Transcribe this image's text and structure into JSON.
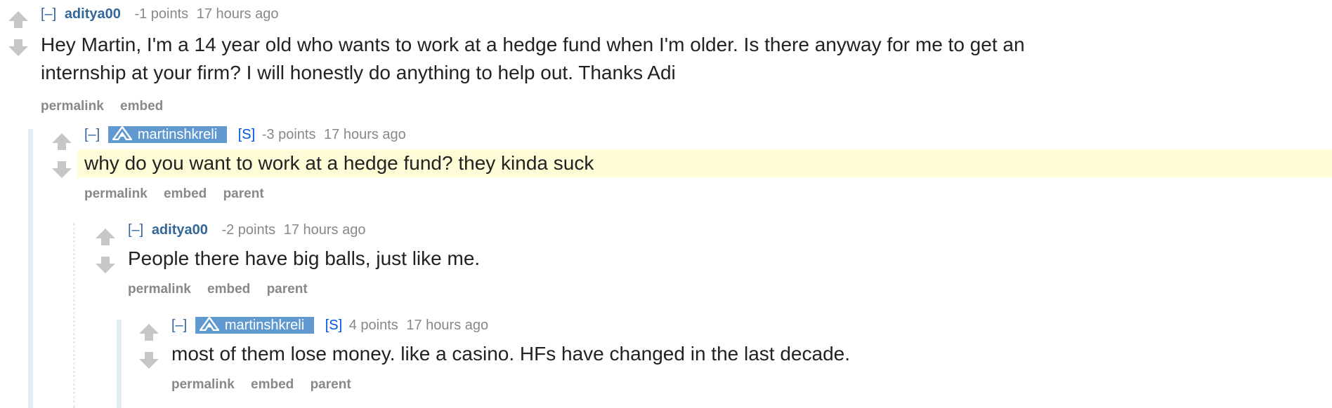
{
  "comments": [
    {
      "expand": "[–]",
      "author": "aditya00",
      "score": "-1 points",
      "time": "17 hours ago",
      "body_lines": [
        "Hey Martin, I'm a 14 year old who wants to work at a hedge fund when I'm older. Is there anyway for me to get an",
        "internship at your firm? I will honestly do anything to help out. Thanks Adi"
      ],
      "buttons": [
        "permalink",
        "embed"
      ]
    },
    {
      "expand": "[–]",
      "author": "martinshkreli",
      "submitter": "[S]",
      "score": "-3 points",
      "time": "17 hours ago",
      "body": "why do you want to work at a hedge fund? they kinda suck",
      "buttons": [
        "permalink",
        "embed",
        "parent"
      ]
    },
    {
      "expand": "[–]",
      "author": "aditya00",
      "score": "-2 points",
      "time": "17 hours ago",
      "body": "People there have big balls, just like me.",
      "buttons": [
        "permalink",
        "embed",
        "parent"
      ]
    },
    {
      "expand": "[–]",
      "author": "martinshkreli",
      "submitter": "[S]",
      "score": "4 points",
      "time": "17 hours ago",
      "body": "most of them lose money. like a casino. HFs have changed in the last decade.",
      "buttons": [
        "permalink",
        "embed",
        "parent"
      ]
    }
  ],
  "colors": {
    "author": "#336699",
    "flair_bg": "#5f99cf",
    "submitter": "#0055df",
    "highlight_bg": "#fffdd7",
    "arrow": "#c6c6c6",
    "thread_line": "#e4edf2"
  }
}
